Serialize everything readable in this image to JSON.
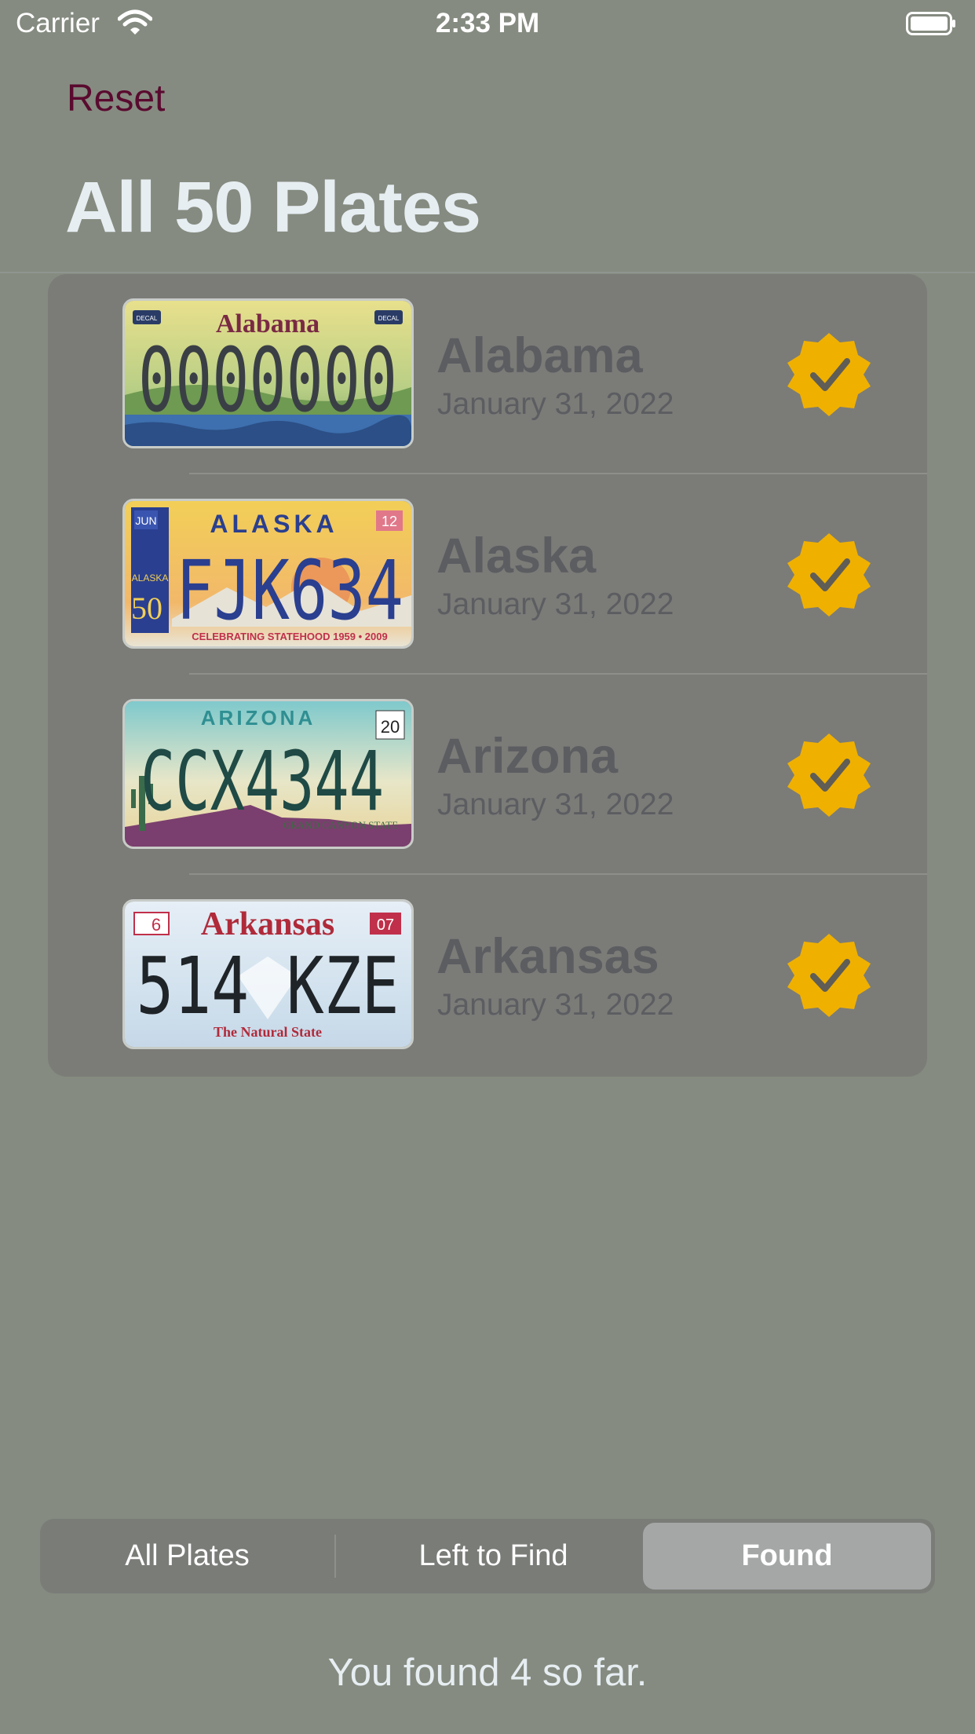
{
  "status_bar": {
    "carrier": "Carrier",
    "time": "2:33 PM"
  },
  "nav": {
    "reset_label": "Reset",
    "title": "All 50 Plates"
  },
  "plates": [
    {
      "state": "Alabama",
      "date": "January 31, 2022",
      "plate_top": "Alabama",
      "plate_number": "0000000",
      "plate_corner_left": "DECAL",
      "plate_corner_right": "DECAL"
    },
    {
      "state": "Alaska",
      "date": "January 31, 2022",
      "plate_top": "ALASKA",
      "plate_number": "FJK634",
      "plate_corner_left": "JUN",
      "plate_corner_right": "12",
      "plate_left_badge": "ALASKA",
      "plate_left_badge_number": "50",
      "plate_bottom": "CELEBRATING STATEHOOD 1959 • 2009"
    },
    {
      "state": "Arizona",
      "date": "January 31, 2022",
      "plate_top": "ARIZONA",
      "plate_number": "CCX4344",
      "plate_corner_right": "20",
      "plate_bottom": "GRAND CANYON STATE"
    },
    {
      "state": "Arkansas",
      "date": "January 31, 2022",
      "plate_top": "Arkansas",
      "plate_number": "514 KZE",
      "plate_corner_left": "6",
      "plate_corner_right": "07",
      "plate_bottom": "The Natural State"
    }
  ],
  "segments": [
    "All Plates",
    "Left to Find",
    "Found"
  ],
  "selected_segment": "Found",
  "footer": {
    "count_text": "You found 4 so far."
  },
  "colors": {
    "background": "#858b80",
    "reset_text": "#5a0a2f",
    "title_text": "#e7eef2",
    "badge": "#f0b000",
    "card": "#7b7c78"
  }
}
